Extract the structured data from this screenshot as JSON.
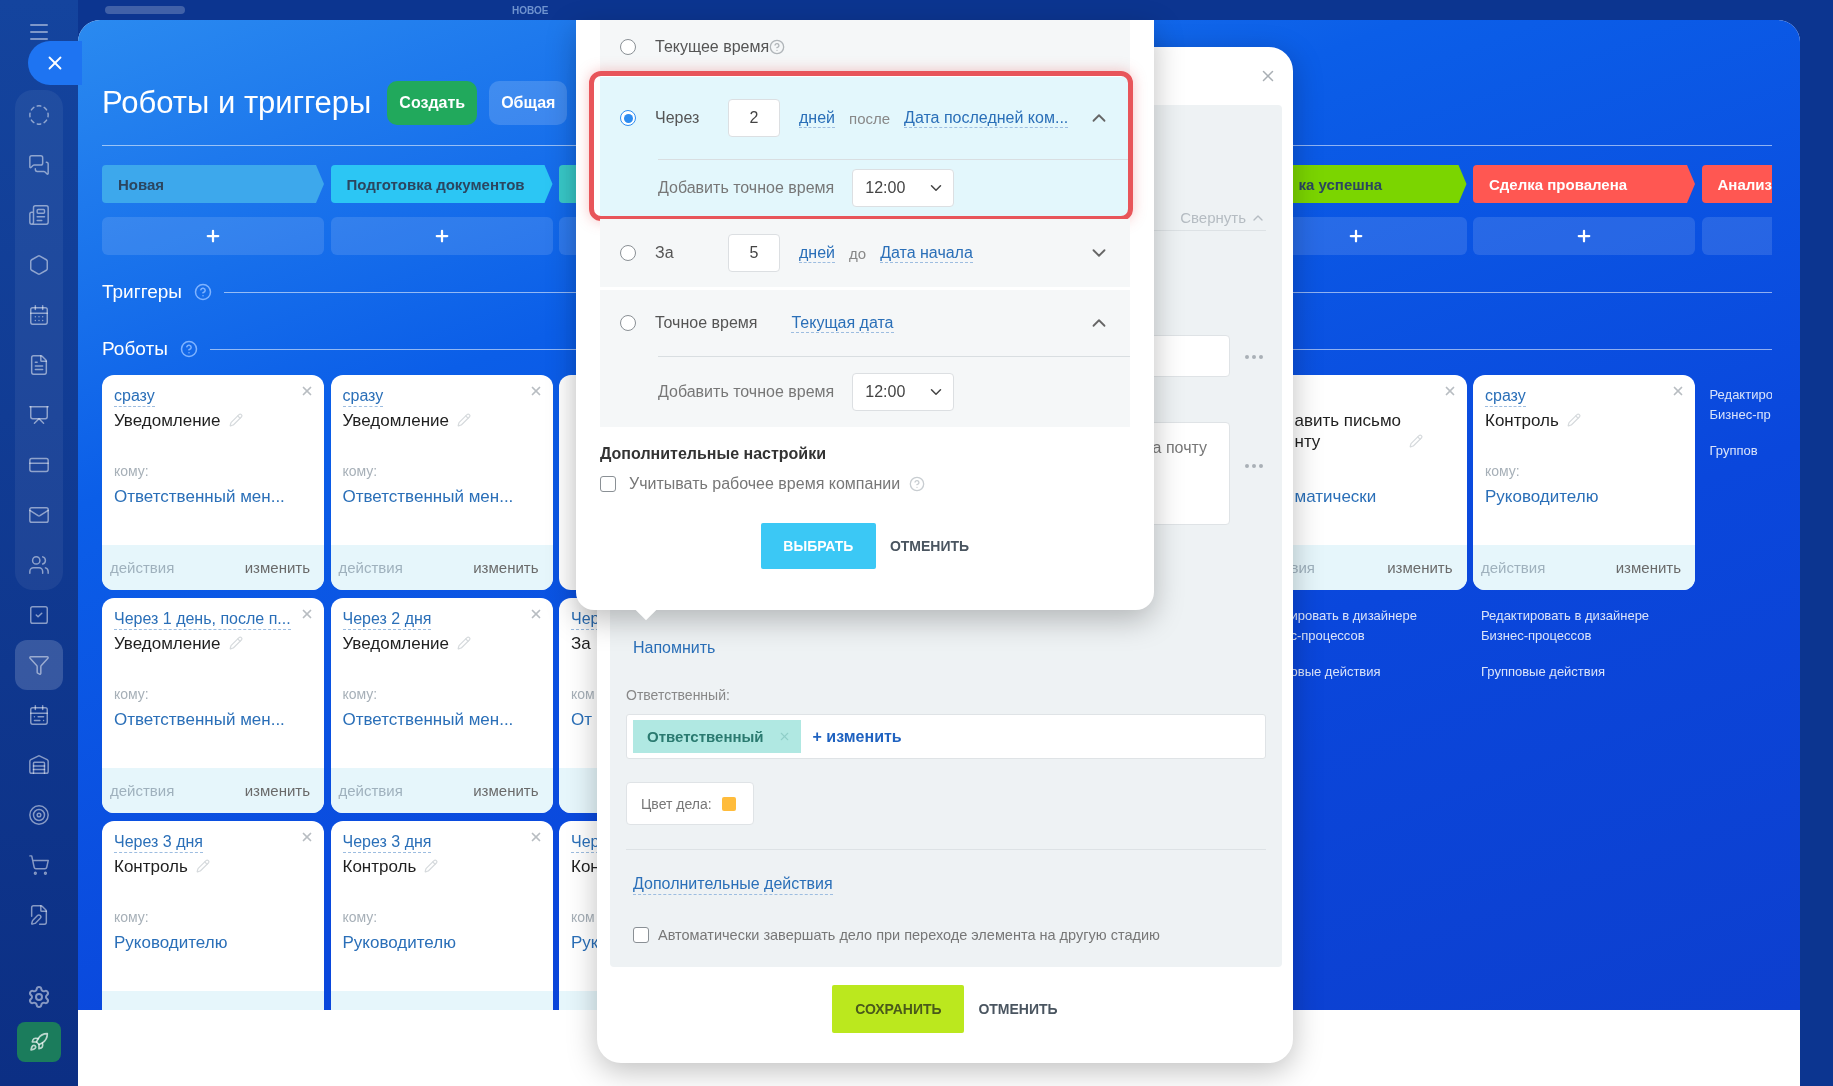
{
  "top_bar": {
    "label": "НОВОЕ"
  },
  "sidebar": {
    "groups": [
      {
        "items": [
          {
            "selected": false
          },
          {
            "selected": false
          },
          {
            "selected": false
          },
          {
            "selected": false
          },
          {
            "selected": false
          },
          {
            "selected": false
          },
          {
            "selected": false
          },
          {
            "selected": false
          },
          {
            "selected": false
          },
          {
            "selected": false
          }
        ]
      },
      {
        "items": [
          {
            "selected": false
          },
          {
            "selected": true
          },
          {
            "selected": false
          },
          {
            "selected": false
          },
          {
            "selected": false
          },
          {
            "selected": false
          },
          {
            "selected": false
          }
        ]
      }
    ]
  },
  "header": {
    "title": "Роботы и триггеры",
    "buttons": [
      {
        "label": "Создать",
        "kind": "primary"
      },
      {
        "label": "Общая",
        "kind": "secondary"
      }
    ]
  },
  "sections": {
    "triggers": "Триггеры",
    "robots": "Роботы"
  },
  "columns": [
    {
      "kind": "full",
      "stage": {
        "label": "Новая",
        "color": "#3da8ec",
        "light_text": false
      },
      "cards": [
        {
          "timing": "сразу",
          "title": "Уведомление",
          "recipient_label": "кому:",
          "recipient": "Ответственный мен...",
          "actions": "действия",
          "edit": "изменить"
        },
        {
          "timing": "Через 1 день, после п...",
          "title": "Уведомление",
          "recipient_label": "кому:",
          "recipient": "Ответственный мен...",
          "actions": "действия",
          "edit": "изменить"
        },
        {
          "timing": "Через 3 дня",
          "title": "Контроль",
          "recipient_label": "кому:",
          "recipient": "Руководителю"
        }
      ]
    },
    {
      "kind": "full",
      "stage": {
        "label": "Подготовка документов",
        "color": "#2cc6f4",
        "light_text": false
      },
      "cards": [
        {
          "timing": "сразу",
          "title": "Уведомление",
          "recipient_label": "кому:",
          "recipient": "Ответственный мен...",
          "actions": "действия",
          "edit": "изменить"
        },
        {
          "timing": "Через 2 дня",
          "title": "Уведомление",
          "recipient_label": "кому:",
          "recipient": "Ответственный мен...",
          "actions": "действия",
          "edit": "изменить"
        },
        {
          "timing": "Через 3 дня",
          "title": "Контроль",
          "recipient_label": "кому:",
          "recipient": "Руководителю"
        }
      ]
    },
    {
      "kind": "sliver",
      "stage": {
        "color": "#38c8c8"
      },
      "cards": [
        {
          "kind": "blank"
        },
        {
          "kind": "robot",
          "timing": "Чер",
          "title": "За",
          "recipient_label": "ком",
          "recipient": "От"
        },
        {
          "kind": "robot",
          "timing": "Чер",
          "title": "Кон",
          "recipient_label": "ком",
          "recipient": "Рук"
        }
      ]
    },
    {
      "kind": "covered"
    },
    {
      "kind": "covered"
    },
    {
      "kind": "partial",
      "stage": {
        "label": "ка успешна",
        "color": "#7bd500",
        "light_text": false
      },
      "cards": [
        {
          "title": "авить письмо\nнту",
          "recipient": "матически",
          "actions": "вия",
          "edit": "изменить"
        }
      ],
      "links": [
        "ировать в дизайнере\nс-процессов",
        "овые действия"
      ]
    },
    {
      "kind": "full",
      "stage": {
        "label": "Сделка провалена",
        "color": "#ff5752",
        "light_text": true
      },
      "cards": [
        {
          "timing": "сразу",
          "title": "Контроль",
          "recipient_label": "кому:",
          "recipient": "Руководителю",
          "actions": "действия",
          "edit": "изменить"
        }
      ],
      "links": [
        "Редактировать в дизайнере\nБизнес-процессов",
        "Групповые действия"
      ]
    },
    {
      "kind": "edge",
      "stage": {
        "label": "Анализ",
        "color": "#ff5752",
        "light_text": true
      },
      "links": [
        "Редактиро\nБизнес-пр",
        "Группов"
      ]
    }
  ],
  "modal": {
    "collapse": "Свернуть",
    "note_fragment": "а почту",
    "remind": "Напомнить",
    "responsible_label": "Ответственный:",
    "responsible_chip": "Ответственный",
    "change": "+ изменить",
    "color_label": "Цвет дела:",
    "more_actions": "Дополнительные действия",
    "auto_complete": {
      "label": "Автоматически завершать дело при переходе элемента на другую стадию",
      "checked": false
    },
    "buttons": [
      {
        "label": "СОХРАНИТЬ",
        "kind": "primary"
      },
      {
        "label": "ОТМЕНИТЬ",
        "kind": "link"
      }
    ]
  },
  "popup": {
    "options": [
      {
        "kind": "now",
        "label": "Текущее время",
        "selected": false
      },
      {
        "kind": "after",
        "label": "Через",
        "value": "2",
        "unit": "дней",
        "relation": "после",
        "field": "Дата последней ком...",
        "selected": true,
        "expanded": true,
        "highlighted": true,
        "time_label": "Добавить точное время",
        "time": "12:00"
      },
      {
        "kind": "before",
        "label": "За",
        "value": "5",
        "unit": "дней",
        "relation": "до",
        "field": "Дата начала",
        "selected": false,
        "expanded": false
      },
      {
        "kind": "exact",
        "label": "Точное время",
        "field": "Текущая дата",
        "selected": false,
        "expanded": true,
        "time_label": "Добавить точное время",
        "time": "12:00"
      }
    ],
    "extra_title": "Дополнительные настройки",
    "work_time": {
      "label": "Учитывать рабочее время компании",
      "checked": false
    },
    "buttons": [
      {
        "label": "ВЫБРАТЬ",
        "kind": "primary"
      },
      {
        "label": "ОТМЕНИТЬ",
        "kind": "link"
      }
    ]
  }
}
